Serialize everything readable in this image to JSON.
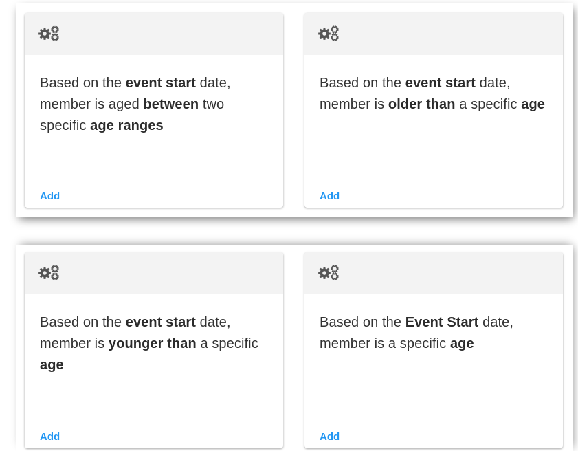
{
  "cards": [
    {
      "segments": [
        {
          "t": "Based on the ",
          "b": false
        },
        {
          "t": "event start",
          "b": true
        },
        {
          "t": " date, member is aged ",
          "b": false
        },
        {
          "t": "between",
          "b": true
        },
        {
          "t": " two specific ",
          "b": false
        },
        {
          "t": "age ranges",
          "b": true
        }
      ],
      "add_label": "Add"
    },
    {
      "segments": [
        {
          "t": "Based on the ",
          "b": false
        },
        {
          "t": "event start",
          "b": true
        },
        {
          "t": " date, member is ",
          "b": false
        },
        {
          "t": "older than",
          "b": true
        },
        {
          "t": " a specific ",
          "b": false
        },
        {
          "t": "age",
          "b": true
        }
      ],
      "add_label": "Add"
    },
    {
      "segments": [
        {
          "t": "Based on the ",
          "b": false
        },
        {
          "t": "event start",
          "b": true
        },
        {
          "t": " date, member is ",
          "b": false
        },
        {
          "t": "younger than",
          "b": true
        },
        {
          "t": " a specific ",
          "b": false
        },
        {
          "t": "age",
          "b": true
        }
      ],
      "add_label": "Add"
    },
    {
      "segments": [
        {
          "t": "Based on the ",
          "b": false
        },
        {
          "t": "Event Start",
          "b": true
        },
        {
          "t": " date, member is a specific ",
          "b": false
        },
        {
          "t": "age",
          "b": true
        }
      ],
      "add_label": "Add"
    }
  ],
  "icons": {
    "header": "gears-icon"
  },
  "colors": {
    "link": "#2196f3",
    "header_bg": "#f3f3f3",
    "text": "#333333"
  }
}
